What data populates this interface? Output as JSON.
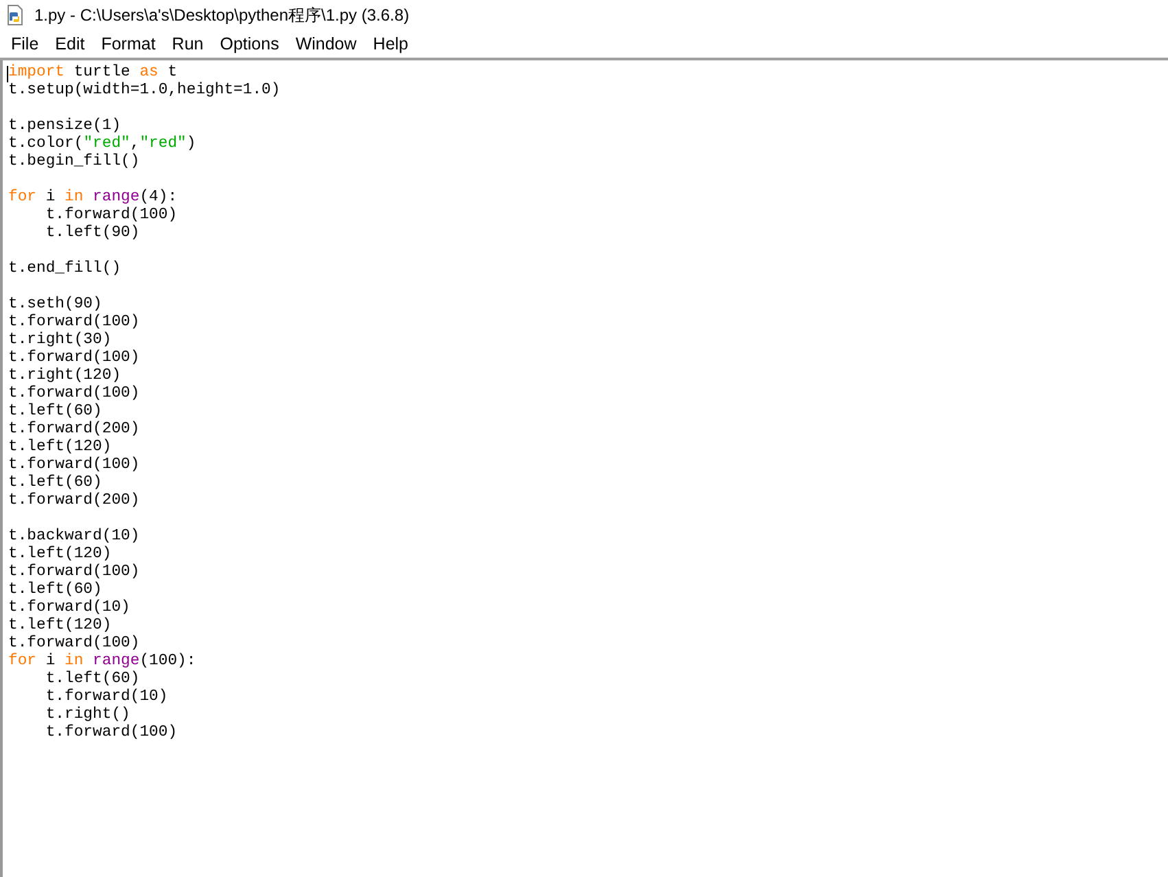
{
  "window": {
    "title": "1.py - C:\\Users\\a's\\Desktop\\pythen程序\\1.py (3.6.8)"
  },
  "menu": [
    "File",
    "Edit",
    "Format",
    "Run",
    "Options",
    "Window",
    "Help"
  ],
  "editor": {
    "lines": [
      {
        "tokens": [
          {
            "kind": "keyword",
            "text": "import"
          },
          {
            "kind": "plain",
            "text": " turtle "
          },
          {
            "kind": "keyword",
            "text": "as"
          },
          {
            "kind": "plain",
            "text": " t"
          }
        ]
      },
      {
        "tokens": [
          {
            "kind": "plain",
            "text": "t.setup(width=1.0,height=1.0)"
          }
        ]
      },
      {
        "gap_before": true,
        "tokens": [
          {
            "kind": "plain",
            "text": "t.pensize(1)"
          }
        ]
      },
      {
        "tokens": [
          {
            "kind": "plain",
            "text": "t.color("
          },
          {
            "kind": "string",
            "text": "\"red\""
          },
          {
            "kind": "plain",
            "text": ","
          },
          {
            "kind": "string",
            "text": "\"red\""
          },
          {
            "kind": "plain",
            "text": ")"
          }
        ]
      },
      {
        "tokens": [
          {
            "kind": "plain",
            "text": "t.begin_fill()"
          }
        ]
      },
      {
        "gap_before": true,
        "tokens": [
          {
            "kind": "keyword",
            "text": "for"
          },
          {
            "kind": "plain",
            "text": " i "
          },
          {
            "kind": "keyword",
            "text": "in"
          },
          {
            "kind": "builtin",
            "text": " range"
          },
          {
            "kind": "plain",
            "text": "(4):"
          }
        ]
      },
      {
        "tokens": [
          {
            "kind": "plain",
            "text": "    t.forward(100)"
          }
        ]
      },
      {
        "tokens": [
          {
            "kind": "plain",
            "text": "    t.left(90)"
          }
        ]
      },
      {
        "gap_before": true,
        "tokens": [
          {
            "kind": "plain",
            "text": "t.end_fill()"
          }
        ]
      },
      {
        "gap_before": true,
        "tokens": [
          {
            "kind": "plain",
            "text": "t.seth(90)"
          }
        ]
      },
      {
        "tokens": [
          {
            "kind": "plain",
            "text": "t.forward(100)"
          }
        ]
      },
      {
        "tokens": [
          {
            "kind": "plain",
            "text": "t.right(30)"
          }
        ]
      },
      {
        "tokens": [
          {
            "kind": "plain",
            "text": "t.forward(100)"
          }
        ]
      },
      {
        "tokens": [
          {
            "kind": "plain",
            "text": "t.right(120)"
          }
        ]
      },
      {
        "tokens": [
          {
            "kind": "plain",
            "text": "t.forward(100)"
          }
        ]
      },
      {
        "tokens": [
          {
            "kind": "plain",
            "text": "t.left(60)"
          }
        ]
      },
      {
        "tokens": [
          {
            "kind": "plain",
            "text": "t.forward(200)"
          }
        ]
      },
      {
        "tokens": [
          {
            "kind": "plain",
            "text": "t.left(120)"
          }
        ]
      },
      {
        "tokens": [
          {
            "kind": "plain",
            "text": "t.forward(100)"
          }
        ]
      },
      {
        "tokens": [
          {
            "kind": "plain",
            "text": "t.left(60)"
          }
        ]
      },
      {
        "tokens": [
          {
            "kind": "plain",
            "text": "t.forward(200)"
          }
        ]
      },
      {
        "gap_before": true,
        "tokens": [
          {
            "kind": "plain",
            "text": "t.backward(10)"
          }
        ]
      },
      {
        "tokens": [
          {
            "kind": "plain",
            "text": "t.left(120)"
          }
        ]
      },
      {
        "tokens": [
          {
            "kind": "plain",
            "text": "t.forward(100)"
          }
        ]
      },
      {
        "tokens": [
          {
            "kind": "plain",
            "text": "t.left(60)"
          }
        ]
      },
      {
        "tokens": [
          {
            "kind": "plain",
            "text": "t.forward(10)"
          }
        ]
      },
      {
        "tokens": [
          {
            "kind": "plain",
            "text": "t.left(120)"
          }
        ]
      },
      {
        "tokens": [
          {
            "kind": "plain",
            "text": "t.forward(100)"
          }
        ]
      },
      {
        "tokens": [
          {
            "kind": "keyword",
            "text": "for"
          },
          {
            "kind": "plain",
            "text": " i "
          },
          {
            "kind": "keyword",
            "text": "in"
          },
          {
            "kind": "builtin",
            "text": " range"
          },
          {
            "kind": "plain",
            "text": "(100):"
          }
        ]
      },
      {
        "tokens": [
          {
            "kind": "plain",
            "text": "    t.left(60)"
          }
        ]
      },
      {
        "tokens": [
          {
            "kind": "plain",
            "text": "    t.forward(10)"
          }
        ]
      },
      {
        "tokens": [
          {
            "kind": "plain",
            "text": "    t.right()"
          }
        ]
      },
      {
        "tokens": [
          {
            "kind": "plain",
            "text": "    t.forward(100)"
          }
        ]
      }
    ]
  }
}
